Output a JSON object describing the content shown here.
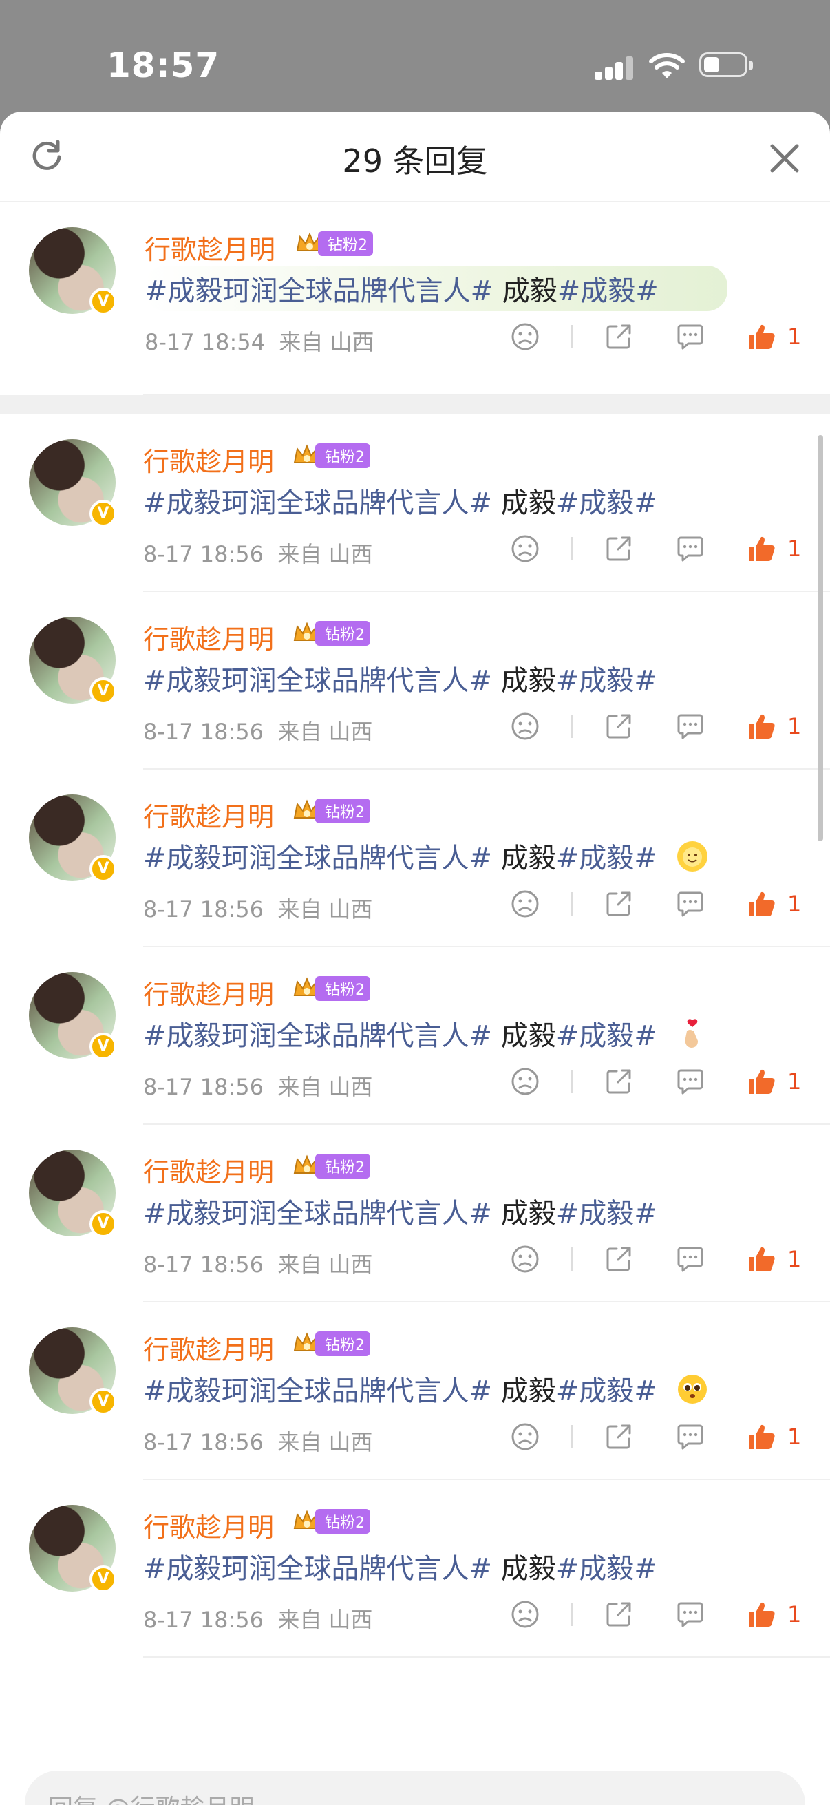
{
  "status_bar": {
    "time": "18:57"
  },
  "header": {
    "title": "29 条回复"
  },
  "comments": [
    {
      "user": "行歌趁月明",
      "fan_badge": "钻粉2",
      "topic1": "#成毅珂润全球品牌代言人#",
      "plain": " 成毅",
      "topic2": "#成毅#",
      "date": "8-17 18:54",
      "location": "来自 山西",
      "likes": "1",
      "emoji": ""
    },
    {
      "user": "行歌趁月明",
      "fan_badge": "钻粉2",
      "topic1": "#成毅珂润全球品牌代言人#",
      "plain": " 成毅",
      "topic2": "#成毅#",
      "date": "8-17 18:56",
      "location": "来自 山西",
      "likes": "1",
      "emoji": ""
    },
    {
      "user": "行歌趁月明",
      "fan_badge": "钻粉2",
      "topic1": "#成毅珂润全球品牌代言人#",
      "plain": " 成毅",
      "topic2": "#成毅#",
      "date": "8-17 18:56",
      "location": "来自 山西",
      "likes": "1",
      "emoji": ""
    },
    {
      "user": "行歌趁月明",
      "fan_badge": "钻粉2",
      "topic1": "#成毅珂润全球品牌代言人#",
      "plain": " 成毅",
      "topic2": "#成毅#",
      "date": "8-17 18:56",
      "location": "来自 山西",
      "likes": "1",
      "emoji": "sun-smile-emoji"
    },
    {
      "user": "行歌趁月明",
      "fan_badge": "钻粉2",
      "topic1": "#成毅珂润全球品牌代言人#",
      "plain": " 成毅",
      "topic2": "#成毅#",
      "date": "8-17 18:56",
      "location": "来自 山西",
      "likes": "1",
      "emoji": "finger-heart-emoji"
    },
    {
      "user": "行歌趁月明",
      "fan_badge": "钻粉2",
      "topic1": "#成毅珂润全球品牌代言人#",
      "plain": " 成毅",
      "topic2": "#成毅#",
      "date": "8-17 18:56",
      "location": "来自 山西",
      "likes": "1",
      "emoji": ""
    },
    {
      "user": "行歌趁月明",
      "fan_badge": "钻粉2",
      "topic1": "#成毅珂润全球品牌代言人#",
      "plain": " 成毅",
      "topic2": "#成毅#",
      "date": "8-17 18:56",
      "location": "来自 山西",
      "likes": "1",
      "emoji": "pleading-face-emoji"
    },
    {
      "user": "行歌趁月明",
      "fan_badge": "钻粉2",
      "topic1": "#成毅珂润全球品牌代言人#",
      "plain": " 成毅",
      "topic2": "#成毅#",
      "date": "8-17 18:56",
      "location": "来自 山西",
      "likes": "1",
      "emoji": ""
    }
  ],
  "reply_bar": {
    "placeholder": "回复 @行歌趁月明"
  },
  "colors": {
    "username": "#f2701a",
    "topic": "#4a5e94",
    "like": "#e8491d",
    "fan_badge": "#b46cf0"
  }
}
